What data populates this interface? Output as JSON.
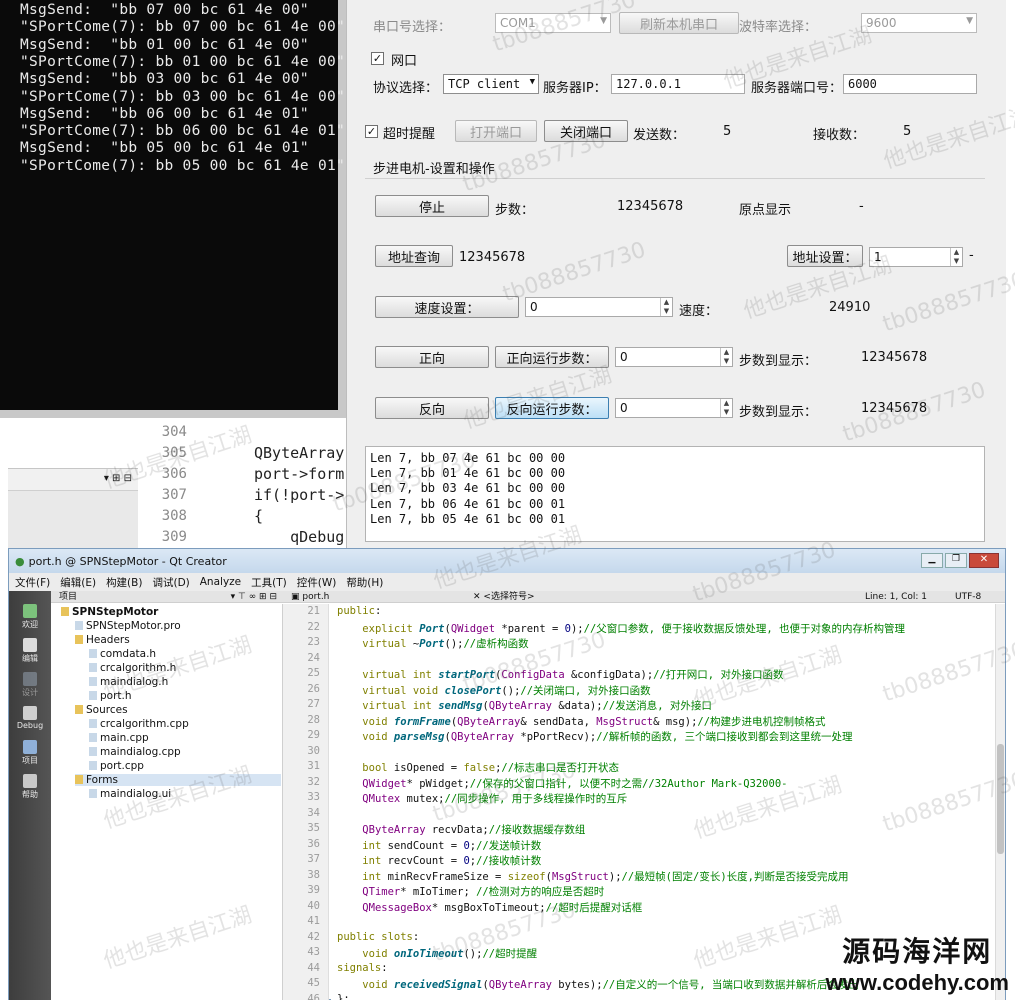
{
  "console": {
    "lines": [
      "MsgSend:  \"bb 07 00 bc 61 4e 00\"",
      "\"SPortCome(7): bb 07 00 bc 61 4e 00\"",
      "MsgSend:  \"bb 01 00 bc 61 4e 00\"",
      "\"SPortCome(7): bb 01 00 bc 61 4e 00\"",
      "MsgSend:  \"bb 03 00 bc 61 4e 00\"",
      "\"SPortCome(7): bb 03 00 bc 61 4e 00\"",
      "MsgSend:  \"bb 06 00 bc 61 4e 01\"",
      "\"SPortCome(7): bb 06 00 bc 61 4e 01\"",
      "MsgSend:  \"bb 05 00 bc 61 4e 01\"",
      "\"SPortCome(7): bb 05 00 bc 61 4e 01\""
    ]
  },
  "bg_editor": {
    "line_numbers": [
      "304",
      "305",
      "306",
      "307",
      "308",
      "309"
    ],
    "code": [
      "",
      "QByteArray",
      "port->form",
      "if(!port->",
      "{",
      "    qDebug"
    ]
  },
  "dialog": {
    "serial_select_label": "串口号选择：",
    "serial_port_value": "COM1",
    "refresh_button": "刷新本机串口",
    "baud_label": "波特率选择：",
    "baud_value": "9600",
    "network_check_label": "网口",
    "protocol_label": "协议选择：",
    "protocol_value": "TCP client",
    "server_ip_label": "服务器IP：",
    "server_ip_value": "127.0.0.1",
    "server_port_label": "服务器端口号：",
    "server_port_value": "6000",
    "timeout_check_label": "超时提醒",
    "open_port_button": "打开端口",
    "close_port_button": "关闭端口",
    "send_count_label": "发送数：",
    "send_count_value": "5",
    "recv_count_label": "接收数：",
    "recv_count_value": "5",
    "section_title": "步进电机-设置和操作",
    "stop_button": "停止",
    "steps_label": "步数：",
    "steps_value": "12345678",
    "origin_label": "原点显示",
    "origin_value": "-",
    "addr_query_button": "地址查询",
    "addr_query_value": "12345678",
    "addr_set_button": "地址设置：",
    "addr_set_value": "1",
    "addr_suffix": "-",
    "speed_set_button": "速度设置：",
    "speed_set_value": "0",
    "speed_label": "速度：",
    "speed_value": "24910",
    "forward_button": "正向",
    "forward_steps_button": "正向运行步数：",
    "forward_steps_value": "0",
    "forward_reached_label": "步数到显示：",
    "forward_reached_value": "12345678",
    "reverse_button": "反向",
    "reverse_steps_button": "反向运行步数：",
    "reverse_steps_value": "0",
    "reverse_reached_label": "步数到显示：",
    "reverse_reached_value": "12345678",
    "log_lines": [
      "Len 7, bb 07 4e 61 bc 00 00",
      "Len 7, bb 01 4e 61 bc 00 00",
      "Len 7, bb 03 4e 61 bc 00 00",
      "Len 7, bb 06 4e 61 bc 00 01",
      "Len 7, bb 05 4e 61 bc 00 01"
    ]
  },
  "creator": {
    "title": "port.h @ SPNStepMotor - Qt Creator",
    "menu": [
      "文件(F)",
      "编辑(E)",
      "构建(B)",
      "调试(D)",
      "Analyze",
      "工具(T)",
      "控件(W)",
      "帮助(H)"
    ],
    "modes": [
      "欢迎",
      "编辑",
      "设计",
      "Debug",
      "项目",
      "帮助"
    ],
    "project_header": "项目",
    "editor_file": "port.h",
    "editor_symbol": "<选择符号>",
    "editor_position": "Line: 1, Col: 1",
    "editor_encoding": "UTF-8",
    "tree": [
      {
        "label": "SPNStepMotor",
        "bold": true
      },
      {
        "label": "SPNStepMotor.pro"
      },
      {
        "label": "Headers"
      },
      {
        "label": "comdata.h"
      },
      {
        "label": "crcalgorithm.h"
      },
      {
        "label": "maindialog.h"
      },
      {
        "label": "port.h"
      },
      {
        "label": "Sources"
      },
      {
        "label": "crcalgorithm.cpp"
      },
      {
        "label": "main.cpp"
      },
      {
        "label": "maindialog.cpp"
      },
      {
        "label": "port.cpp"
      },
      {
        "label": "Forms"
      },
      {
        "label": "maindialog.ui"
      }
    ],
    "line_numbers": [
      "21",
      "22",
      "23",
      "24",
      "25",
      "26",
      "27",
      "28",
      "29",
      "30",
      "31",
      "32",
      "33",
      "34",
      "35",
      "36",
      "37",
      "38",
      "39",
      "40",
      "41",
      "42",
      "43",
      "44",
      "45",
      "46"
    ],
    "code_lines": [
      "public:",
      "    explicit Port(QWidget *parent = 0);//父窗口参数, 便于接收数据反馈处理, 也便于对象的内存析构管理",
      "    virtual ~Port();//虚析构函数",
      "",
      "    virtual int startPort(ConfigData &configData);//打开网口, 对外接口函数",
      "    virtual void closePort();//关闭端口, 对外接口函数",
      "    virtual int sendMsg(QByteArray &data);//发送消息, 对外接口",
      "    void formFrame(QByteArray& sendData, MsgStruct& msg);//构建步进电机控制帧格式",
      "    void parseMsg(QByteArray *pPortRecv);//解析帧的函数, 三个端口接收到都会到这里统一处理",
      "",
      "    bool isOpened = false;//标志串口是否打开状态",
      "    QWidget* pWidget;//保存的父窗口指针, 以便不时之需//32Author Mark-Q32000-",
      "    QMutex mutex;//同步操作, 用于多线程操作时的互斥",
      "",
      "    QByteArray recvData;//接收数据缓存数组",
      "    int sendCount = 0;//发送帧计数",
      "    int recvCount = 0;//接收帧计数",
      "    int minRecvFrameSize = sizeof(MsgStruct);//最短帧(固定/变长)长度,判断是否接受完成用",
      "    QTimer* mIoTimer; //检测对方的响应是否超时",
      "    QMessageBox* msgBoxToTimeout;//超时后提醒对话框",
      "",
      "public slots:",
      "    void onIoTimeout();//超时提醒",
      "signals:",
      "    void receivedSignal(QByteArray bytes);//自定义的一个信号, 当端口收到数据并解析后会发出",
      "};"
    ]
  },
  "watermark": {
    "code": "tb088857730",
    "text": "他也是来自江湖"
  },
  "logo": {
    "title": "源码海洋网",
    "url": "www.codehy.com"
  }
}
